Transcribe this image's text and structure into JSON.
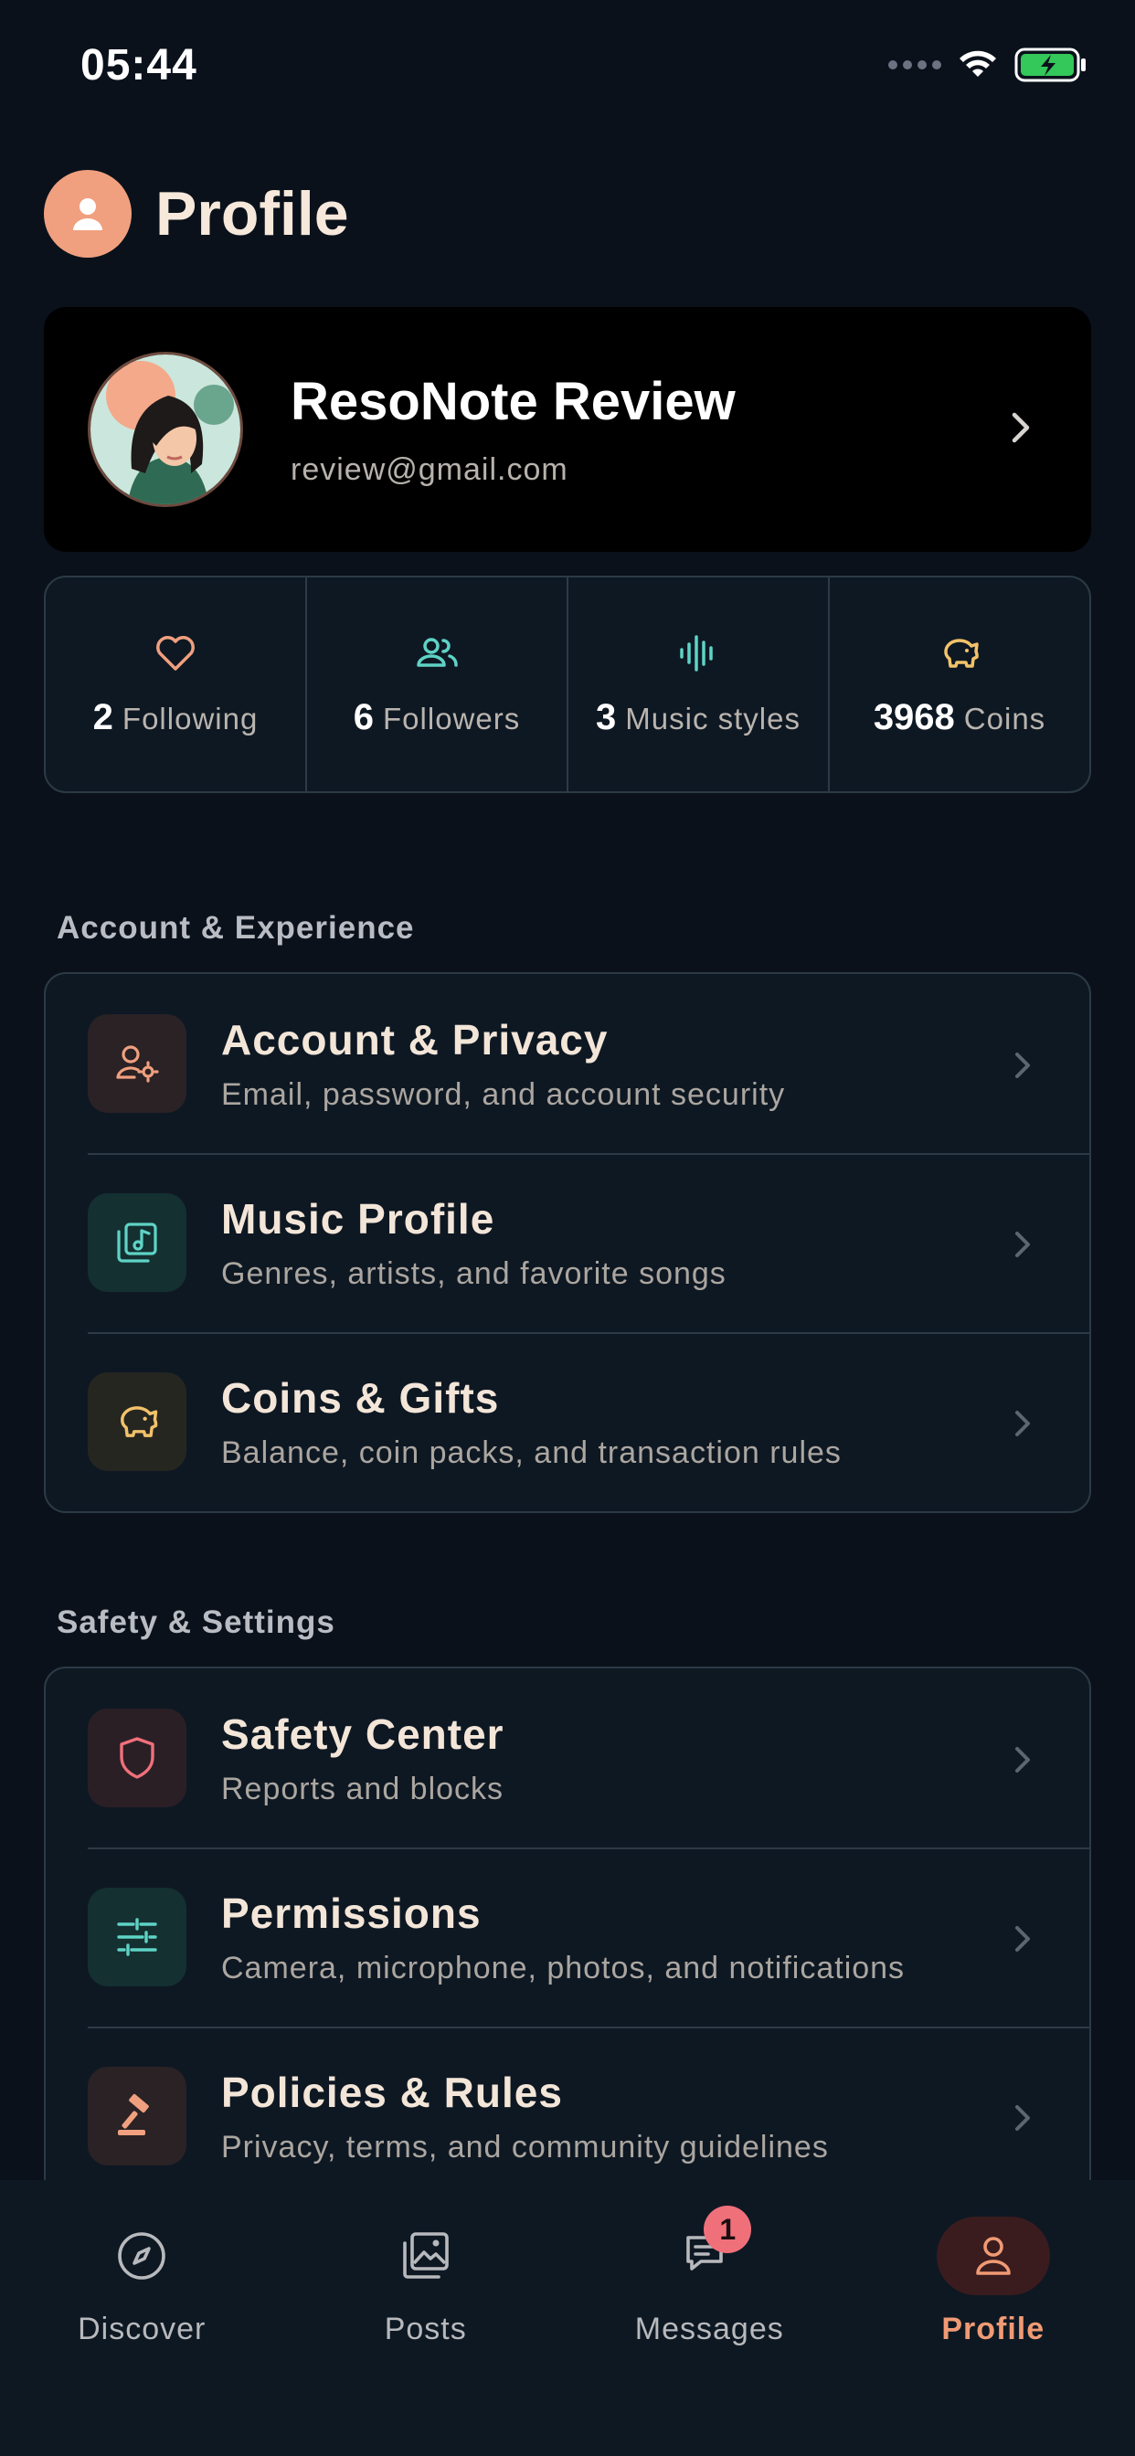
{
  "status_bar": {
    "time": "05:44"
  },
  "header": {
    "title": "Profile"
  },
  "profile": {
    "name": "ResoNote Review",
    "email": "review@gmail.com"
  },
  "stats": [
    {
      "value": "2",
      "label": "Following",
      "icon": "heart-icon"
    },
    {
      "value": "6",
      "label": "Followers",
      "icon": "users-icon"
    },
    {
      "value": "3",
      "label": "Music styles",
      "icon": "soundwave-icon"
    },
    {
      "value": "3968",
      "label": "Coins",
      "icon": "piggy-bank-icon"
    }
  ],
  "sections": [
    {
      "title": "Account & Experience",
      "items": [
        {
          "title": "Account & Privacy",
          "subtitle": "Email, password, and account security",
          "icon": "user-gear-icon",
          "color": "#f0a07f"
        },
        {
          "title": "Music Profile",
          "subtitle": "Genres, artists, and favorite songs",
          "icon": "music-library-icon",
          "color": "#5ed3c6"
        },
        {
          "title": "Coins & Gifts",
          "subtitle": "Balance, coin packs, and transaction rules",
          "icon": "piggy-bank-icon",
          "color": "#f2c26a"
        }
      ]
    },
    {
      "title": "Safety & Settings",
      "items": [
        {
          "title": "Safety Center",
          "subtitle": "Reports and blocks",
          "icon": "shield-icon",
          "color": "#f0707a"
        },
        {
          "title": "Permissions",
          "subtitle": "Camera, microphone, photos, and notifications",
          "icon": "sliders-icon",
          "color": "#5ed3c6"
        },
        {
          "title": "Policies & Rules",
          "subtitle": "Privacy, terms, and community guidelines",
          "icon": "gavel-icon",
          "color": "#f0a07f"
        }
      ]
    }
  ],
  "nav": [
    {
      "label": "Discover",
      "icon": "compass-icon"
    },
    {
      "label": "Posts",
      "icon": "gallery-icon"
    },
    {
      "label": "Messages",
      "icon": "chat-icon",
      "badge": "1"
    },
    {
      "label": "Profile",
      "icon": "person-icon",
      "active": true
    }
  ],
  "colors": {
    "accent": "#f09a74",
    "background": "#0a111b",
    "card": "#0e1823",
    "badge": "#f0707a"
  }
}
